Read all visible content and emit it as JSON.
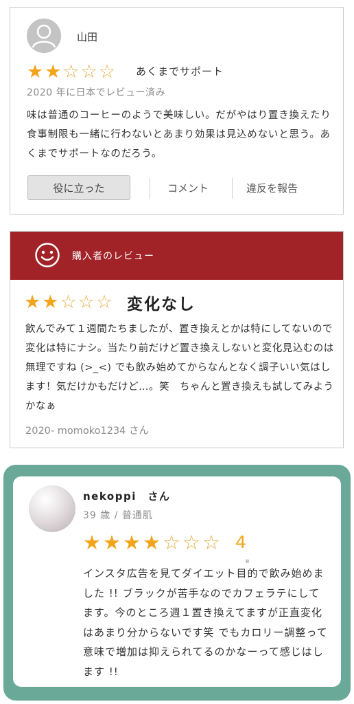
{
  "review1": {
    "reviewer": "山田",
    "rating": 2,
    "max_rating": 5,
    "title": "あくまでサポート",
    "date": "2020 年に日本でレビュー済み",
    "body": "味は普通のコーヒーのようで美味しい。だがやはり置き換えたり食事制限も一緒に行わないとあまり効果は見込めないと思う。あくまでサポートなのだろう。",
    "helpful_label": "役に立った",
    "comment_label": "コメント",
    "report_label": "違反を報告"
  },
  "review2": {
    "header_label": "購入者のレビュー",
    "rating": 2,
    "max_rating": 5,
    "title": "変化なし",
    "body": "飲んでみて１週間たちましたが、置き換えとかは特にしてないので変化は特にナシ。当たり前だけど置き換えしないと変化見込むのは無理ですね (>_<) でも飲み始めてからなんとなく調子いい気はします！気だけかもだけど…。笑　ちゃんと置き換えも試してみようかなぁ",
    "meta": "2020- momoko1234 さん"
  },
  "review3": {
    "reviewer": "nekoppi　さん",
    "profile": "39 歳 / 普通肌",
    "rating": 4,
    "max_rating": 7,
    "rating_text": "4",
    "body": "インスタ広告を見てダイエット目的で飲み始めました !! ブラックが苦手なのでカフェラテにしてます。今のところ週１置き換えてますが正直変化はあまり分からないです笑 でもカロリー調整って意味で増加は抑えられてるのかなーって感じはします !!",
    "reg_mark": "®"
  },
  "colors": {
    "star": "#f2a51c",
    "header_red": "#a12328",
    "frame_green": "#6aa898"
  },
  "icons": {
    "avatar1": "user-silhouette-icon",
    "header": "smiley-face-icon",
    "star": "star-icon"
  }
}
